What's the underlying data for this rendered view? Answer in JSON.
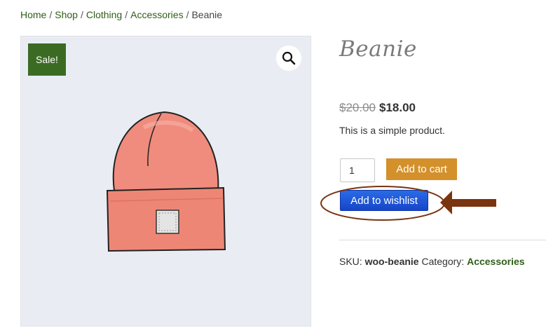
{
  "breadcrumb": {
    "items": [
      "Home",
      "Shop",
      "Clothing",
      "Accessories"
    ],
    "separator": "/",
    "current": "Beanie"
  },
  "gallery": {
    "sale_badge": "Sale!",
    "zoom_icon": "magnifier-icon",
    "image": "beanie-illustration"
  },
  "product": {
    "title": "Beanie",
    "price_old": "$20.00",
    "price_new": "$18.00",
    "description": "This is a simple product.",
    "quantity": "1",
    "add_to_cart_label": "Add to cart",
    "add_to_wishlist_label": "Add to wishlist",
    "sku_label": "SKU:",
    "sku_value": "woo-beanie",
    "category_label": "Category:",
    "category_value": "Accessories"
  },
  "colors": {
    "link_green": "#2f5e17",
    "sale_badge": "#3b6b23",
    "add_to_cart": "#d4902b",
    "wishlist_blue": "#1f55d8",
    "annotation_brown": "#7a3410"
  }
}
